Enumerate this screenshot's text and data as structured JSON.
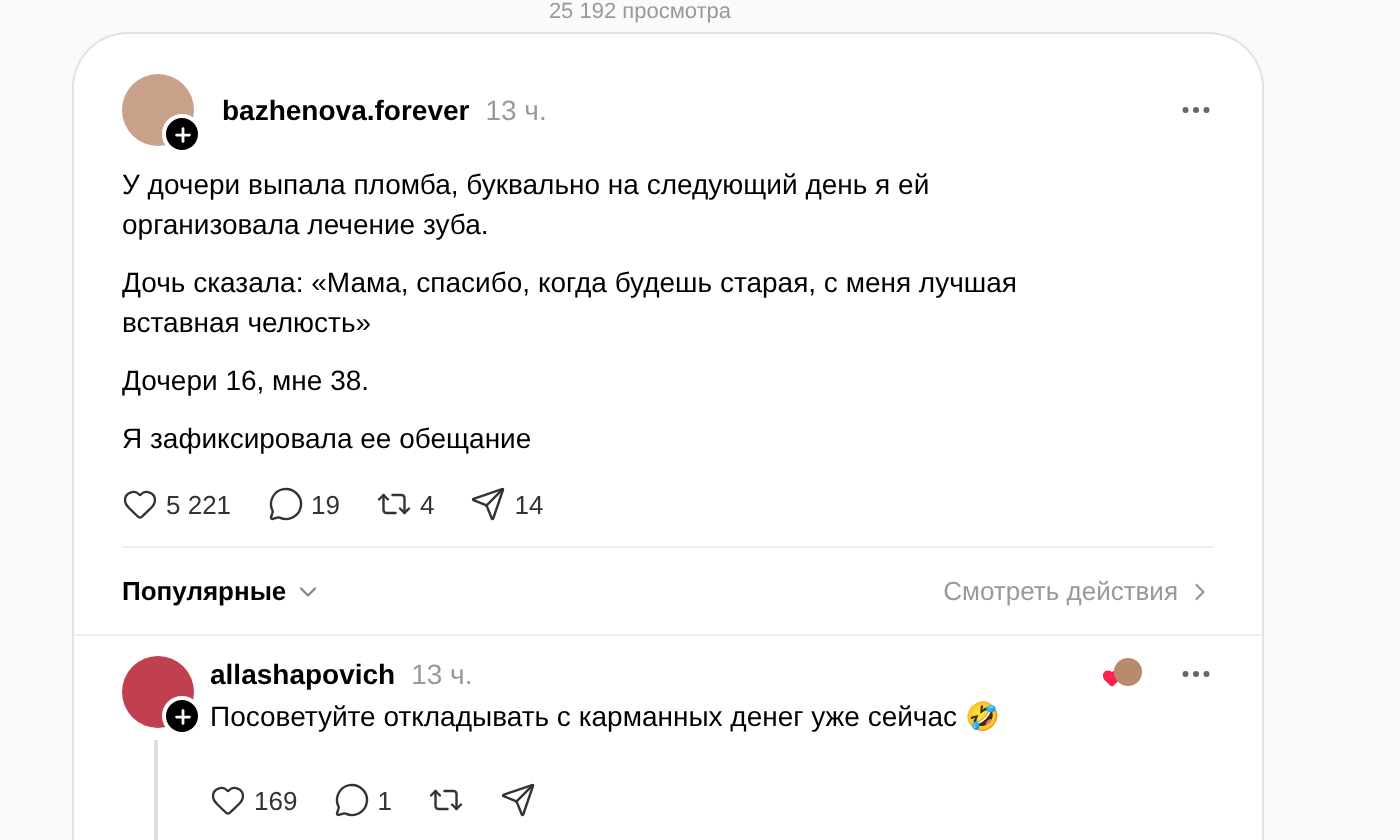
{
  "views": "25 192 просмотра",
  "post": {
    "author": "bazhenova.forever",
    "time": "13 ч.",
    "paragraphs": [
      "У дочери выпала пломба, буквально на следующий день я ей организовала лечение зуба.",
      "Дочь сказала: «Мама, спасибо, когда будешь старая, с меня лучшая вставная челюсть»",
      "Дочери 16, мне 38.",
      "Я зафиксировала ее обещание"
    ],
    "stats": [
      {
        "kind": "like",
        "count": "5 221"
      },
      {
        "kind": "comment",
        "count": "19"
      },
      {
        "kind": "repost",
        "count": "4"
      },
      {
        "kind": "share",
        "count": "14"
      }
    ]
  },
  "sort": {
    "label": "Популярные",
    "activity_link": "Смотреть действия"
  },
  "comments": [
    {
      "author": "allashapovich",
      "time": "13 ч.",
      "text": "Посоветуйте откладывать с карманных денег уже сейчас 🤣",
      "liked_by_author": true,
      "stats": [
        {
          "kind": "like",
          "count": "169"
        },
        {
          "kind": "comment",
          "count": "1"
        },
        {
          "kind": "repost"
        },
        {
          "kind": "share"
        }
      ]
    }
  ]
}
